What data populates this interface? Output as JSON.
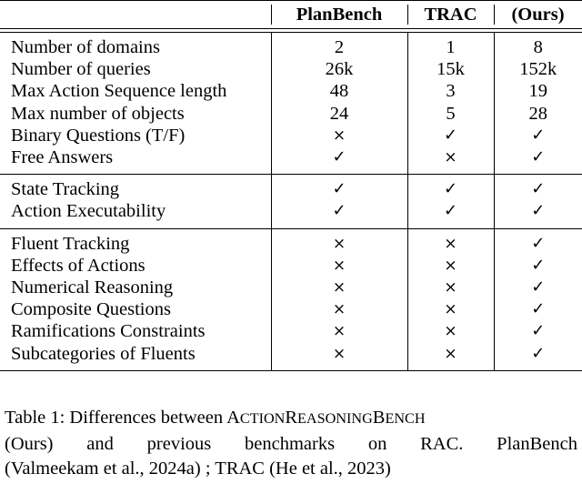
{
  "table": {
    "columns": [
      "",
      "PlanBench",
      "TRAC",
      "(Ours)"
    ],
    "check_glyph": "✓",
    "cross_glyph": "×",
    "sections": [
      {
        "rows": [
          {
            "label": "Number of domains",
            "planbench": "2",
            "trac": "1",
            "ours": "8"
          },
          {
            "label": "Number of queries",
            "planbench": "26k",
            "trac": "15k",
            "ours": "152k"
          },
          {
            "label": "Max Action Sequence length",
            "planbench": "48",
            "trac": "3",
            "ours": "19"
          },
          {
            "label": "Max number of objects",
            "planbench": "24",
            "trac": "5",
            "ours": "28"
          },
          {
            "label": "Binary Questions (T/F)",
            "planbench": "×",
            "trac": "✓",
            "ours": "✓"
          },
          {
            "label": "Free Answers",
            "planbench": "✓",
            "trac": "×",
            "ours": "✓"
          }
        ]
      },
      {
        "rows": [
          {
            "label": "State Tracking",
            "planbench": "✓",
            "trac": "✓",
            "ours": "✓"
          },
          {
            "label": "Action Executability",
            "planbench": "✓",
            "trac": "✓",
            "ours": "✓"
          }
        ]
      },
      {
        "rows": [
          {
            "label": "Fluent Tracking",
            "planbench": "×",
            "trac": "×",
            "ours": "✓"
          },
          {
            "label": "Effects of Actions",
            "planbench": "×",
            "trac": "×",
            "ours": "✓"
          },
          {
            "label": "Numerical Reasoning",
            "planbench": "×",
            "trac": "×",
            "ours": "✓"
          },
          {
            "label": "Composite Questions",
            "planbench": "×",
            "trac": "×",
            "ours": "✓"
          },
          {
            "label": "Ramifications Constraints",
            "planbench": "×",
            "trac": "×",
            "ours": "✓"
          },
          {
            "label": "Subcategories of Fluents",
            "planbench": "×",
            "trac": "×",
            "ours": "✓"
          }
        ]
      }
    ]
  },
  "caption": {
    "line1_pre": "Table 1: Differences between ",
    "benchmark_name": {
      "a": "A",
      "ction": "CTION",
      "r": "R",
      "easoning": "EASONING",
      "b": "B",
      "ench": "ENCH"
    },
    "line2": "(Ours) and previous benchmarks on RAC. PlanBench",
    "line3": "(Valmeekam et al., 2024a) ; TRAC (He et al., 2023)"
  }
}
